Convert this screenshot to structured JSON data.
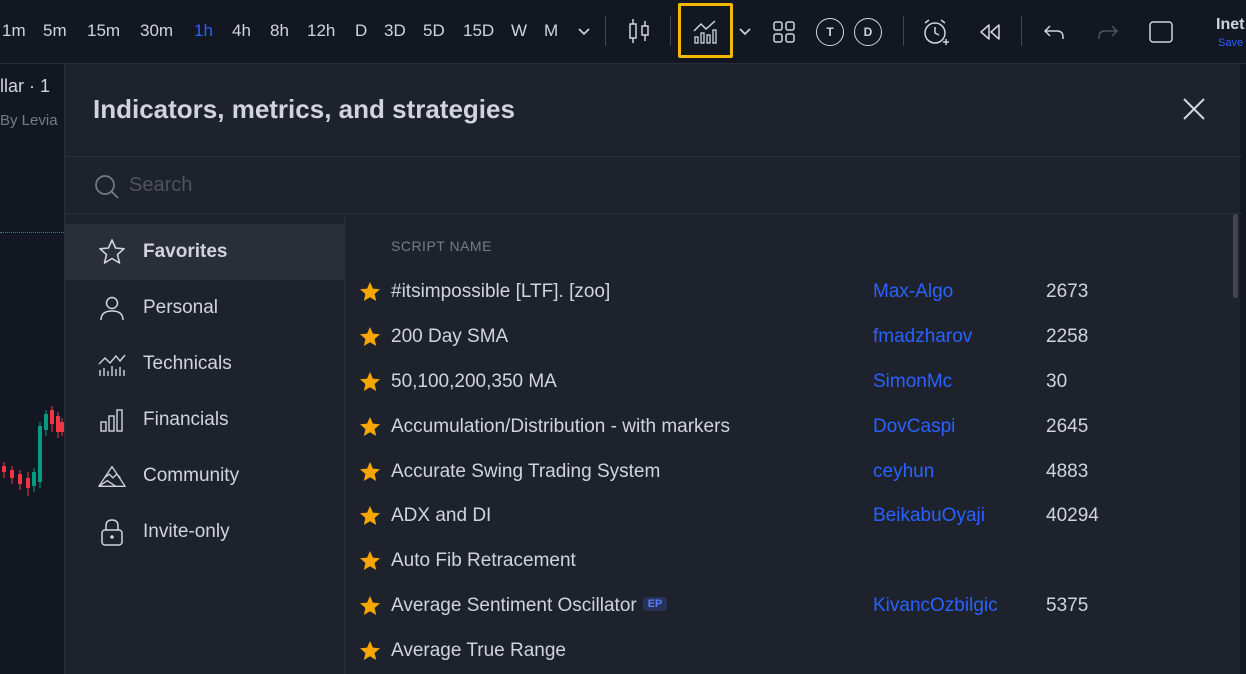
{
  "toolbar": {
    "timeframes": [
      "1m",
      "5m",
      "15m",
      "30m",
      "1h",
      "4h",
      "8h",
      "12h",
      "D",
      "3D",
      "5D",
      "15D",
      "W",
      "M"
    ],
    "active_timeframe": "1h",
    "circle_buttons": [
      "T",
      "D"
    ],
    "layout_name": "Inet",
    "save_status": "Save"
  },
  "chart": {
    "title_fragment": "llar · 1",
    "author_fragment": "By Levia"
  },
  "dialog": {
    "title": "Indicators, metrics, and strategies",
    "search_placeholder": "Search"
  },
  "sidebar": {
    "items": [
      {
        "label": "Favorites",
        "icon": "star-outline-icon",
        "active": true
      },
      {
        "label": "Personal",
        "icon": "user-icon",
        "active": false
      },
      {
        "label": "Technicals",
        "icon": "chart-bars-icon",
        "active": false
      },
      {
        "label": "Financials",
        "icon": "financials-bars-icon",
        "active": false
      },
      {
        "label": "Community",
        "icon": "community-mountain-icon",
        "active": false
      },
      {
        "label": "Invite-only",
        "icon": "lock-icon",
        "active": false
      }
    ]
  },
  "list": {
    "column_header": "SCRIPT NAME",
    "rows": [
      {
        "name": "#itsimpossible [LTF]. [zoo]",
        "author": "Max-Algo",
        "count": "2673",
        "badge": ""
      },
      {
        "name": "200 Day SMA",
        "author": "fmadzharov",
        "count": "2258",
        "badge": ""
      },
      {
        "name": "50,100,200,350 MA",
        "author": "SimonMc",
        "count": "30",
        "badge": ""
      },
      {
        "name": "Accumulation/Distribution - with markers",
        "author": "DovCaspi",
        "count": "2645",
        "badge": ""
      },
      {
        "name": "Accurate Swing Trading System",
        "author": "ceyhun",
        "count": "4883",
        "badge": ""
      },
      {
        "name": "ADX and DI",
        "author": "BeikabuOyaji",
        "count": "40294",
        "badge": ""
      },
      {
        "name": "Auto Fib Retracement",
        "author": "",
        "count": "",
        "badge": ""
      },
      {
        "name": "Average Sentiment Oscillator",
        "author": "KivancOzbilgic",
        "count": "5375",
        "badge": "EP"
      },
      {
        "name": "Average True Range",
        "author": "",
        "count": "",
        "badge": ""
      }
    ]
  },
  "colors": {
    "background": "#131722",
    "dialog": "#1e222d",
    "accent": "#2962ff",
    "star": "#f7a600",
    "highlight": "#f5b800"
  }
}
